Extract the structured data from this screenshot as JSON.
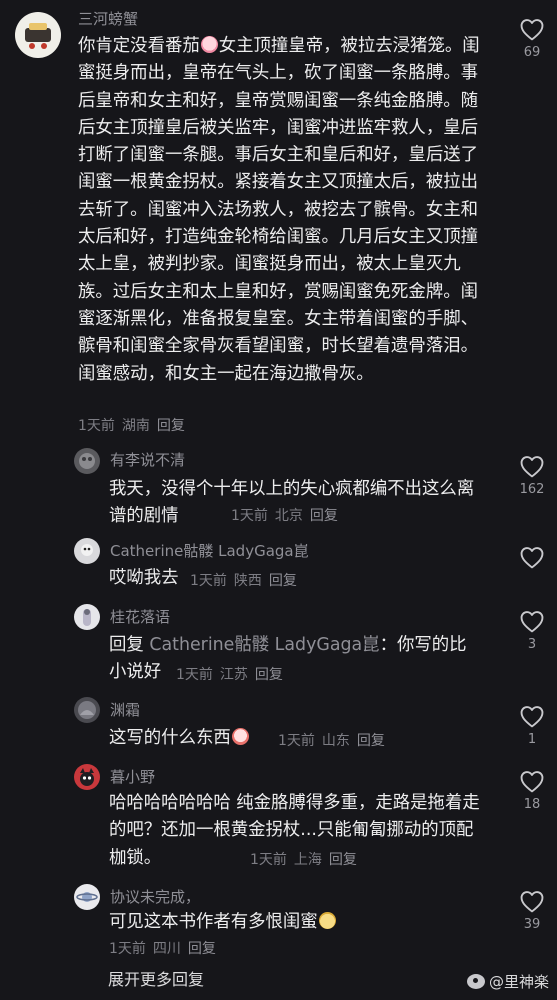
{
  "comments": [
    {
      "username": "三河螃蟹",
      "text_before": "你肯定没看番茄",
      "text_after": "女主顶撞皇帝，被拉去浸猪笼。闺蜜挺身而出，皇帝在气头上，砍了闺蜜一条胳膊。事后皇帝和女主和好，皇帝赏赐闺蜜一条纯金胳膊。随后女主顶撞皇后被关监牢，闺蜜冲进监牢救人，皇后打断了闺蜜一条腿。事后女主和皇后和好，皇后送了闺蜜一根黄金拐杖。紧接着女主又顶撞太后，被拉出去斩了。闺蜜冲入法场救人，被挖去了髌骨。女主和太后和好，打造纯金轮椅给闺蜜。几月后女主又顶撞太上皇，被判抄家。闺蜜挺身而出，被太上皇灭九族。过后女主和太上皇和好，赏赐闺蜜免死金牌。闺蜜逐渐黑化，准备报复皇室。女主带着闺蜜的手脚、髌骨和闺蜜全家骨灰看望闺蜜，时长望着遗骨落泪。闺蜜感动，和女主一起在海边撒骨灰。",
      "time": "1天前",
      "location": "湖南",
      "reply": "回复",
      "likes": "69"
    },
    {
      "username": "有李说不清",
      "text": "我天，没得个十年以上的失心疯都编不出这么离谱的剧情",
      "time": "1天前",
      "location": "北京",
      "reply": "回复",
      "likes": "162"
    },
    {
      "username": "Catherine骷髅 LadyGaga崑",
      "text": "哎呦我去",
      "time": "1天前",
      "location": "陕西",
      "reply": "回复",
      "likes": ""
    },
    {
      "username": "桂花落语",
      "reply_prefix": "回复",
      "reply_to": "Catherine骷髅 LadyGaga崑",
      "text": "：你写的比小说好",
      "time": "1天前",
      "location": "江苏",
      "reply": "回复",
      "likes": "3"
    },
    {
      "username": "渊霜",
      "text": "这写的什么东西",
      "time": "1天前",
      "location": "山东",
      "reply": "回复",
      "likes": "1"
    },
    {
      "username": "暮小野",
      "text": "哈哈哈哈哈哈哈 纯金胳膊得多重，走路是拖着走的吧？还加一根黄金拐杖...只能匍匐挪动的顶配枷锁。",
      "time": "1天前",
      "location": "上海",
      "reply": "回复",
      "likes": "18"
    },
    {
      "username": "协议未完成，",
      "text": "可见这本书作者有多恨闺蜜",
      "time": "1天前",
      "location": "四川",
      "reply": "回复",
      "likes": "39"
    }
  ],
  "expand_more": "展开更多回复",
  "watermark": "@里神楽",
  "icons": {
    "like": "heart-outline-icon",
    "emoji_crying": "crying-emoji-icon",
    "emoji_scream": "screaming-emoji-icon",
    "emoji_cat": "cat-emoji-icon",
    "watermark": "weibo-logo-icon"
  },
  "colors": {
    "background": "#16161a",
    "text": "#ededee",
    "muted": "#7d7d84"
  }
}
